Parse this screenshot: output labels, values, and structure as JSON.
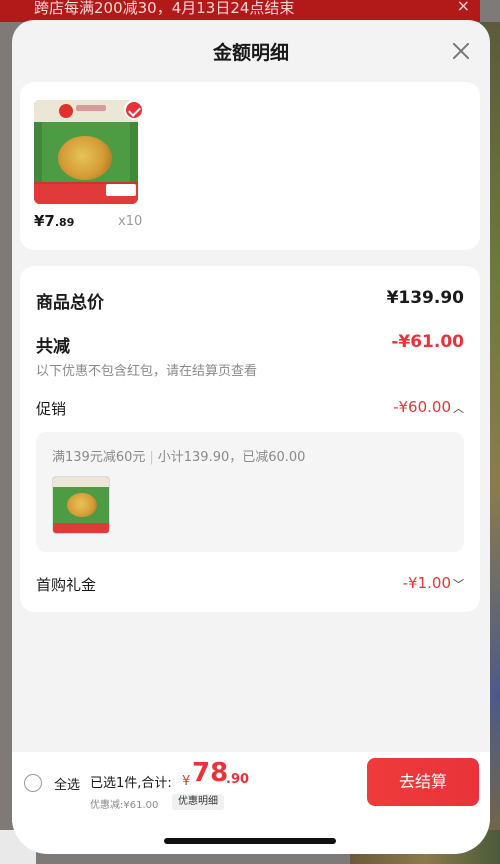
{
  "background": {
    "banner_text": "跨店每满200减30，4月13日24点结束"
  },
  "sheet": {
    "title": "金额明细"
  },
  "product": {
    "price_main": "¥7",
    "price_decimal": ".89",
    "quantity": "x10"
  },
  "summary": {
    "total_label": "商品总价",
    "total_value": "¥139.90",
    "reduce_label": "共减",
    "reduce_value": "-¥61.00",
    "note": "以下优惠不包含红包，请在结算页查看",
    "promo_label": "促销",
    "promo_value": "-¥60.00",
    "promo_rule": "满139元减60元",
    "promo_subtotal": "小计139.90，已减60.00",
    "gift_label": "首购礼金",
    "gift_value": "-¥1.00"
  },
  "bottom_bar": {
    "select_all": "全选",
    "selected_text": "已选1件,合计:",
    "currency": "¥",
    "total_int": "78",
    "total_dec": ".90",
    "discount_text": "优惠减:¥61.00",
    "detail_tag": "优惠明细",
    "checkout_label": "去结算"
  },
  "colors": {
    "accent_red": "#e8333a",
    "sheet_bg": "#f3f3f3"
  }
}
